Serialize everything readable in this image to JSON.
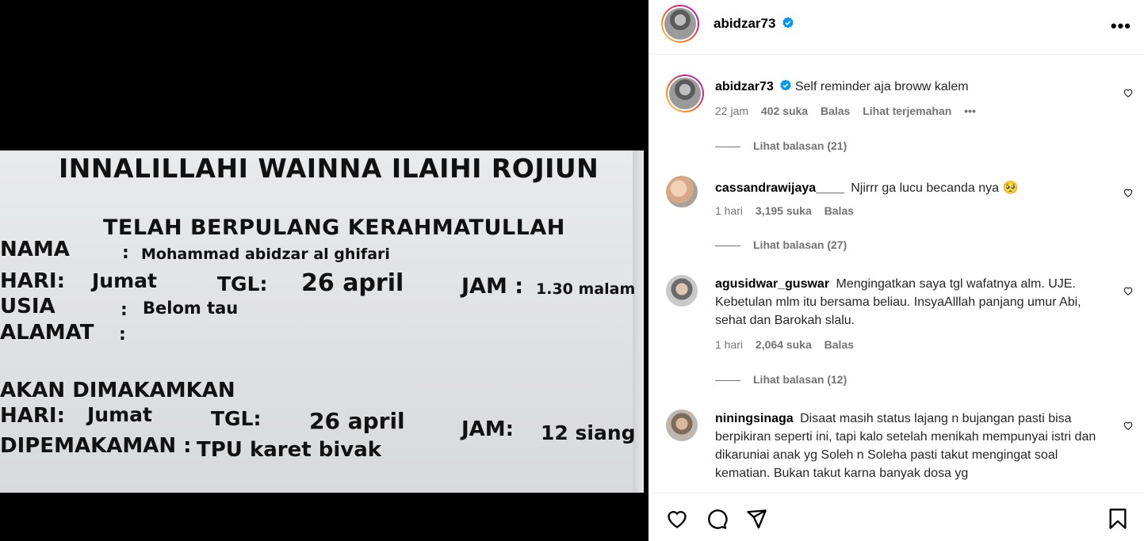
{
  "sign": {
    "title": "INNALILLAHI WAINNA ILAIHI ROJIUN",
    "subtitle": "TELAH BERPULANG KERAHMATULLAH",
    "nama_label": "NAMA",
    "colon": ":",
    "nama_value": "Mohammad abidzar al ghifari",
    "hari1_label": "HARI:",
    "hari1_value": "Jumat",
    "tgl1_label": "TGL:",
    "tgl1_value": "26 april",
    "jam1_label": "JAM :",
    "jam1_value": "1.30 malam",
    "usia_label": "USIA",
    "usia_value": "Belom tau",
    "alamat_label": "ALAMAT",
    "akan_label": "AKAN DIMAKAMKAN",
    "hari2_label": "HARI:",
    "hari2_value": "Jumat",
    "tgl2_label": "TGL:",
    "tgl2_value": "26 april",
    "jam2_label": "JAM:",
    "jam2_value": "12 siang",
    "dipem_label": "DIPEMAKAMAN :",
    "dipem_value": "TPU karet bivak"
  },
  "header": {
    "username": "abidzar73",
    "verified_icon": "verified-badge-icon",
    "more_icon": "more-options-icon",
    "more_glyph": "•••"
  },
  "caption": {
    "username": "abidzar73",
    "text": "Self reminder aja broww kalem",
    "time": "22 jam",
    "likes": "402 suka",
    "reply": "Balas",
    "translate": "Lihat terjemahan",
    "more_glyph": "•••",
    "view_replies": "Lihat balasan (21)"
  },
  "comments": [
    {
      "username": "cassandrawijaya____",
      "text": "Njirrr ga lucu becanda nya 🥺",
      "time": "1 hari",
      "likes": "3,195 suka",
      "reply": "Balas",
      "view_replies": "Lihat balasan (27)"
    },
    {
      "username": "agusidwar_guswar",
      "text": "Mengingatkan saya tgl wafatnya alm. UJE. Kebetulan mlm itu bersama beliau. InsyaAlllah panjang umur Abi, sehat dan Barokah slalu.",
      "time": "1 hari",
      "likes": "2,064 suka",
      "reply": "Balas",
      "view_replies": "Lihat balasan (12)"
    },
    {
      "username": "niningsinaga",
      "text": "Disaat masih status lajang n bujangan pasti bisa berpikiran seperti ini, tapi kalo setelah menikah mempunyai istri dan dikaruniai anak yg Soleh n Soleha pasti takut mengingat soal kematian. Bukan takut karna banyak dosa yg"
    }
  ],
  "actions": {
    "like_icon": "heart-icon",
    "comment_icon": "comment-icon",
    "share_icon": "share-icon",
    "save_icon": "bookmark-icon"
  },
  "colors": {
    "verified": "#0095f6",
    "muted": "#737373",
    "text": "#262626"
  }
}
